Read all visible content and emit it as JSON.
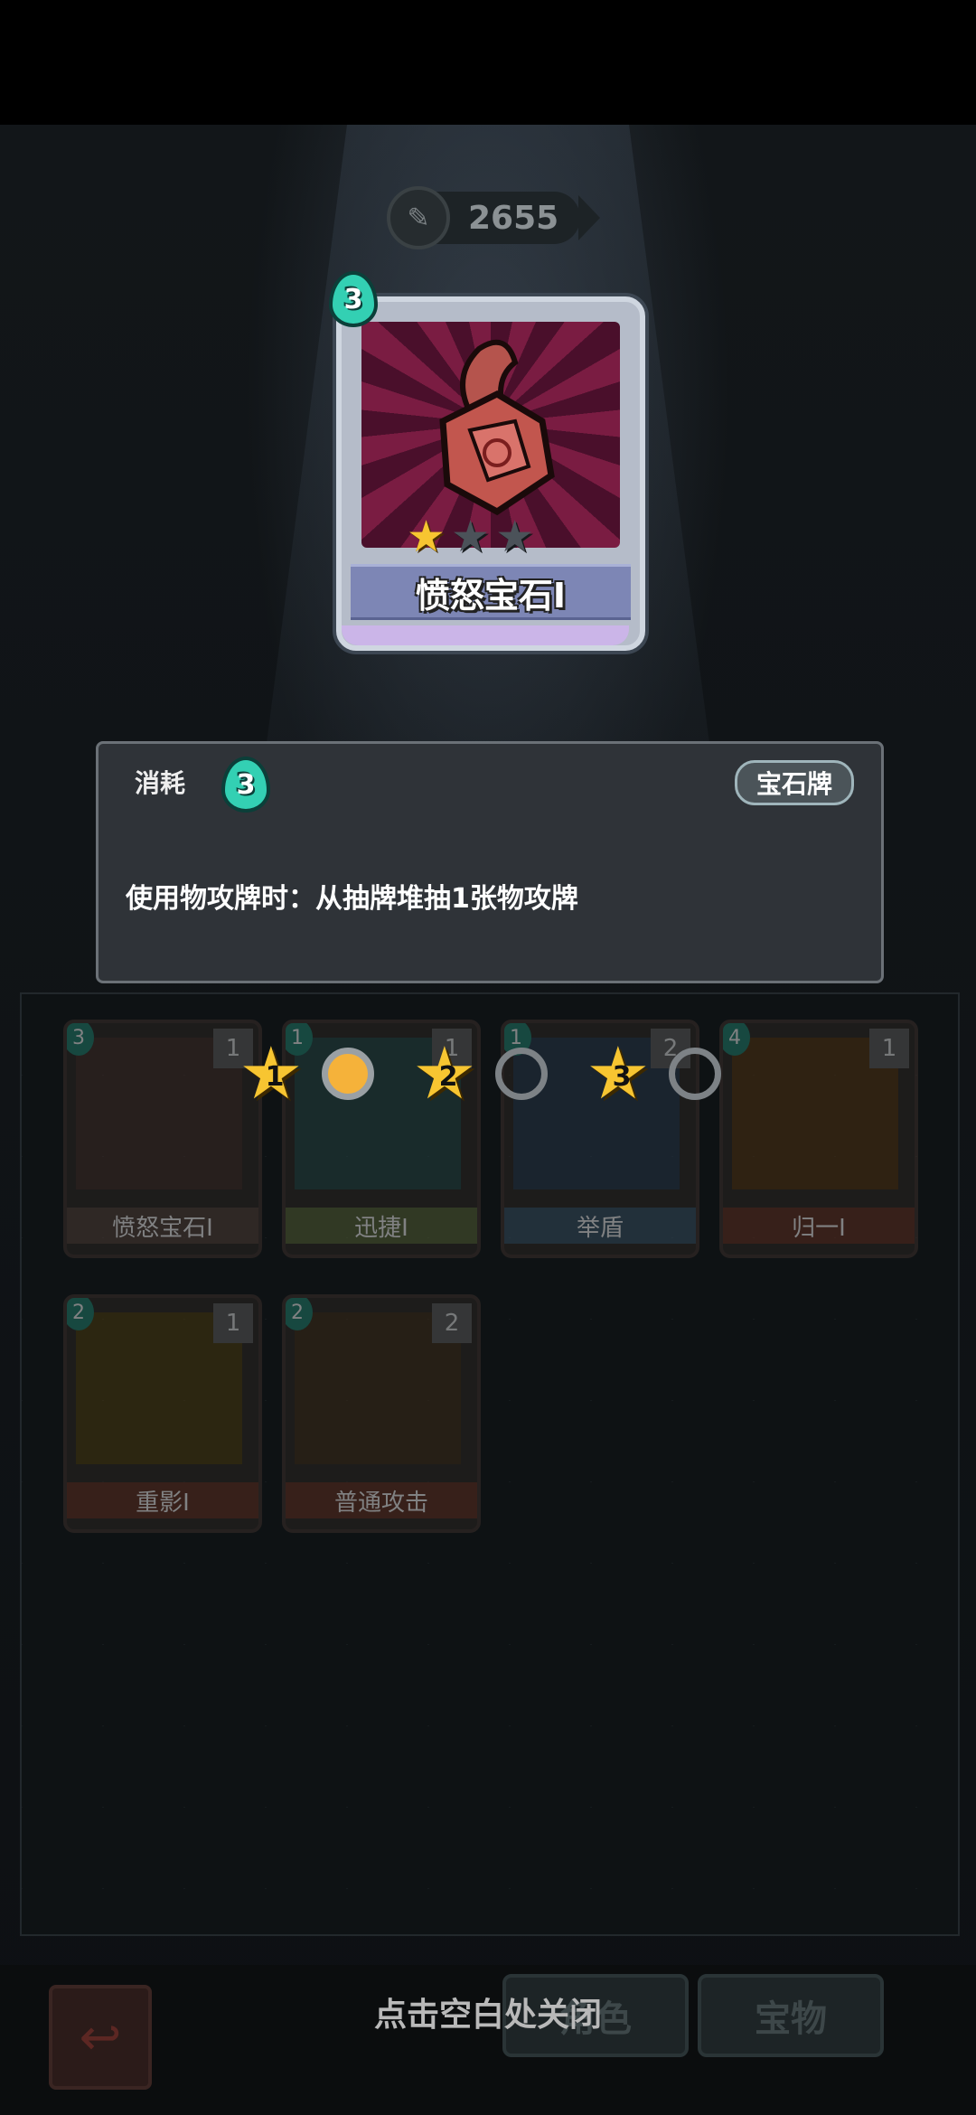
{
  "currency": {
    "amount": "2655",
    "icon": "pen-coin-icon"
  },
  "selected_card": {
    "name": "愤怒宝石I",
    "cost": "3",
    "stars_on": 1,
    "stars_total": 3
  },
  "detail_panel": {
    "cost_label": "消耗",
    "cost_value": "3",
    "type_tag": "宝石牌",
    "description": "使用物攻牌时：从抽牌堆抽1张物攻牌"
  },
  "upgrade_tiers": [
    {
      "label": "1",
      "filled": true
    },
    {
      "label": "2",
      "filled": false
    },
    {
      "label": "3",
      "filled": false
    }
  ],
  "deck": [
    {
      "name": "愤怒宝石I",
      "cost": "3",
      "level": "1"
    },
    {
      "name": "迅捷I",
      "cost": "1",
      "level": "1"
    },
    {
      "name": "举盾",
      "cost": "1",
      "level": "2"
    },
    {
      "name": "归一I",
      "cost": "4",
      "level": "1"
    },
    {
      "name": "重影I",
      "cost": "2",
      "level": "1"
    },
    {
      "name": "普通攻击",
      "cost": "2",
      "level": "2"
    }
  ],
  "bottom": {
    "close_hint": "点击空白处关闭",
    "tab_role": "角色",
    "tab_treasure": "宝物"
  }
}
